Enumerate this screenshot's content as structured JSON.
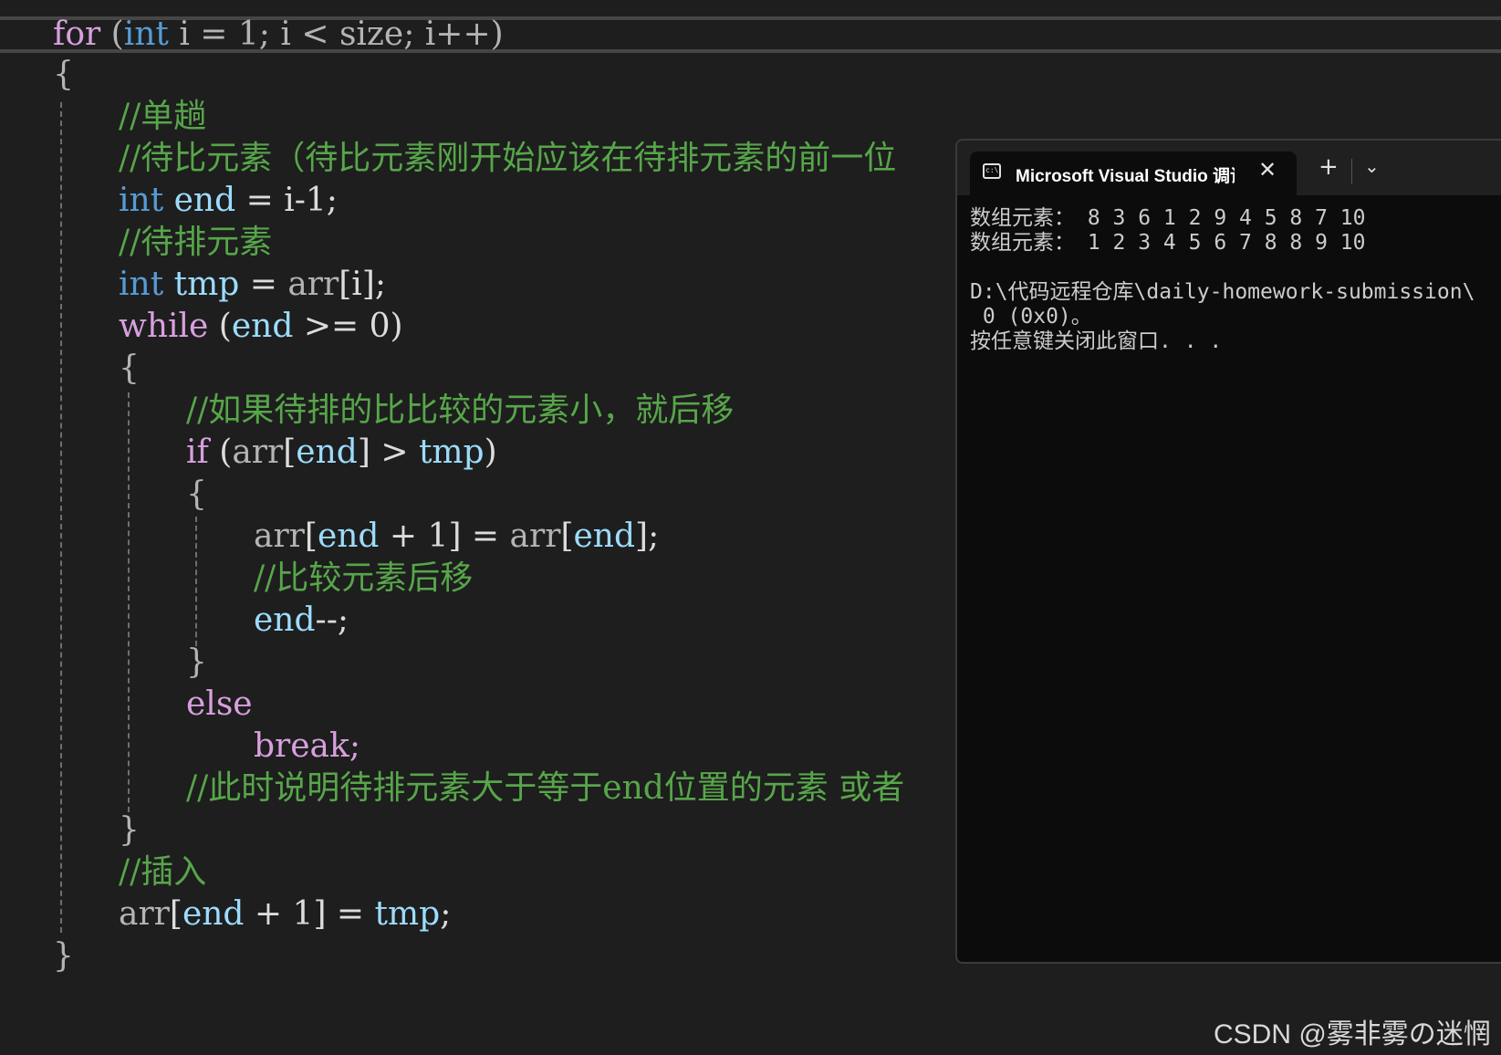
{
  "code": {
    "line01": {
      "kw_for": "for",
      "open": "(",
      "kw_int": "int",
      "rest": " i = 1; i < size; i++)"
    },
    "line02": "{",
    "line03": "//单趟",
    "line04": "//待比元素（待比元素刚开始应该在待排元素的前一位",
    "line05": {
      "kw": "int",
      "var": "end",
      "rest": " = i-1;"
    },
    "line06": "//待排元素",
    "line07": {
      "kw": "int",
      "var": "tmp",
      "rest1": " = ",
      "plain": "arr",
      "rest2": "[i];"
    },
    "line08": {
      "kw": "while",
      "rest1": " (",
      "var": "end",
      "rest2": " >= 0)"
    },
    "line09": "{",
    "line10": "//如果待排的比比较的元素小，就后移",
    "line11": {
      "kw": "if",
      "rest1": " (",
      "plain": "arr",
      "b1": "[",
      "var": "end",
      "b2": "] > ",
      "var2": "tmp",
      "close": ")"
    },
    "line12": "{",
    "line13": {
      "plain1": "arr",
      "b1": "[",
      "var": "end",
      "mid": " + 1] = ",
      "plain2": "arr",
      "b2": "[",
      "var2": "end",
      "end": "];"
    },
    "line14": "//比较元素后移",
    "line15": {
      "var": "end",
      "rest": "--;"
    },
    "line16": "}",
    "line17": "else",
    "line18": "break;",
    "line19": "//此时说明待排元素大于等于end位置的元素 或者",
    "line20": "}",
    "line21": "//插入",
    "line22": {
      "plain": "arr",
      "b1": "[",
      "var": "end",
      "mid": " + 1] = ",
      "var2": "tmp",
      "end": ";"
    },
    "line23": "}"
  },
  "console": {
    "tab_title": "Microsoft Visual Studio 调试控制台",
    "close_glyph": "✕",
    "new_tab_glyph": "+",
    "dropdown_glyph": "⌄",
    "lines": [
      "数组元素： 8 3 6 1 2 9 4 5 8 7 10",
      "数组元素： 1 2 3 4 5 6 7 8 8 9 10",
      "",
      "D:\\代码远程仓库\\daily-homework-submission\\",
      " 0 (0x0)。",
      "按任意键关闭此窗口. . ."
    ]
  },
  "watermark": "CSDN @雾非雾の迷惘",
  "colors": {
    "background": "#1e1e1e",
    "keyword": "#569cd6",
    "control_keyword": "#d8a0df",
    "comment": "#57a64a",
    "variable": "#9cdcfe",
    "console_bg": "#0c0c0c"
  }
}
